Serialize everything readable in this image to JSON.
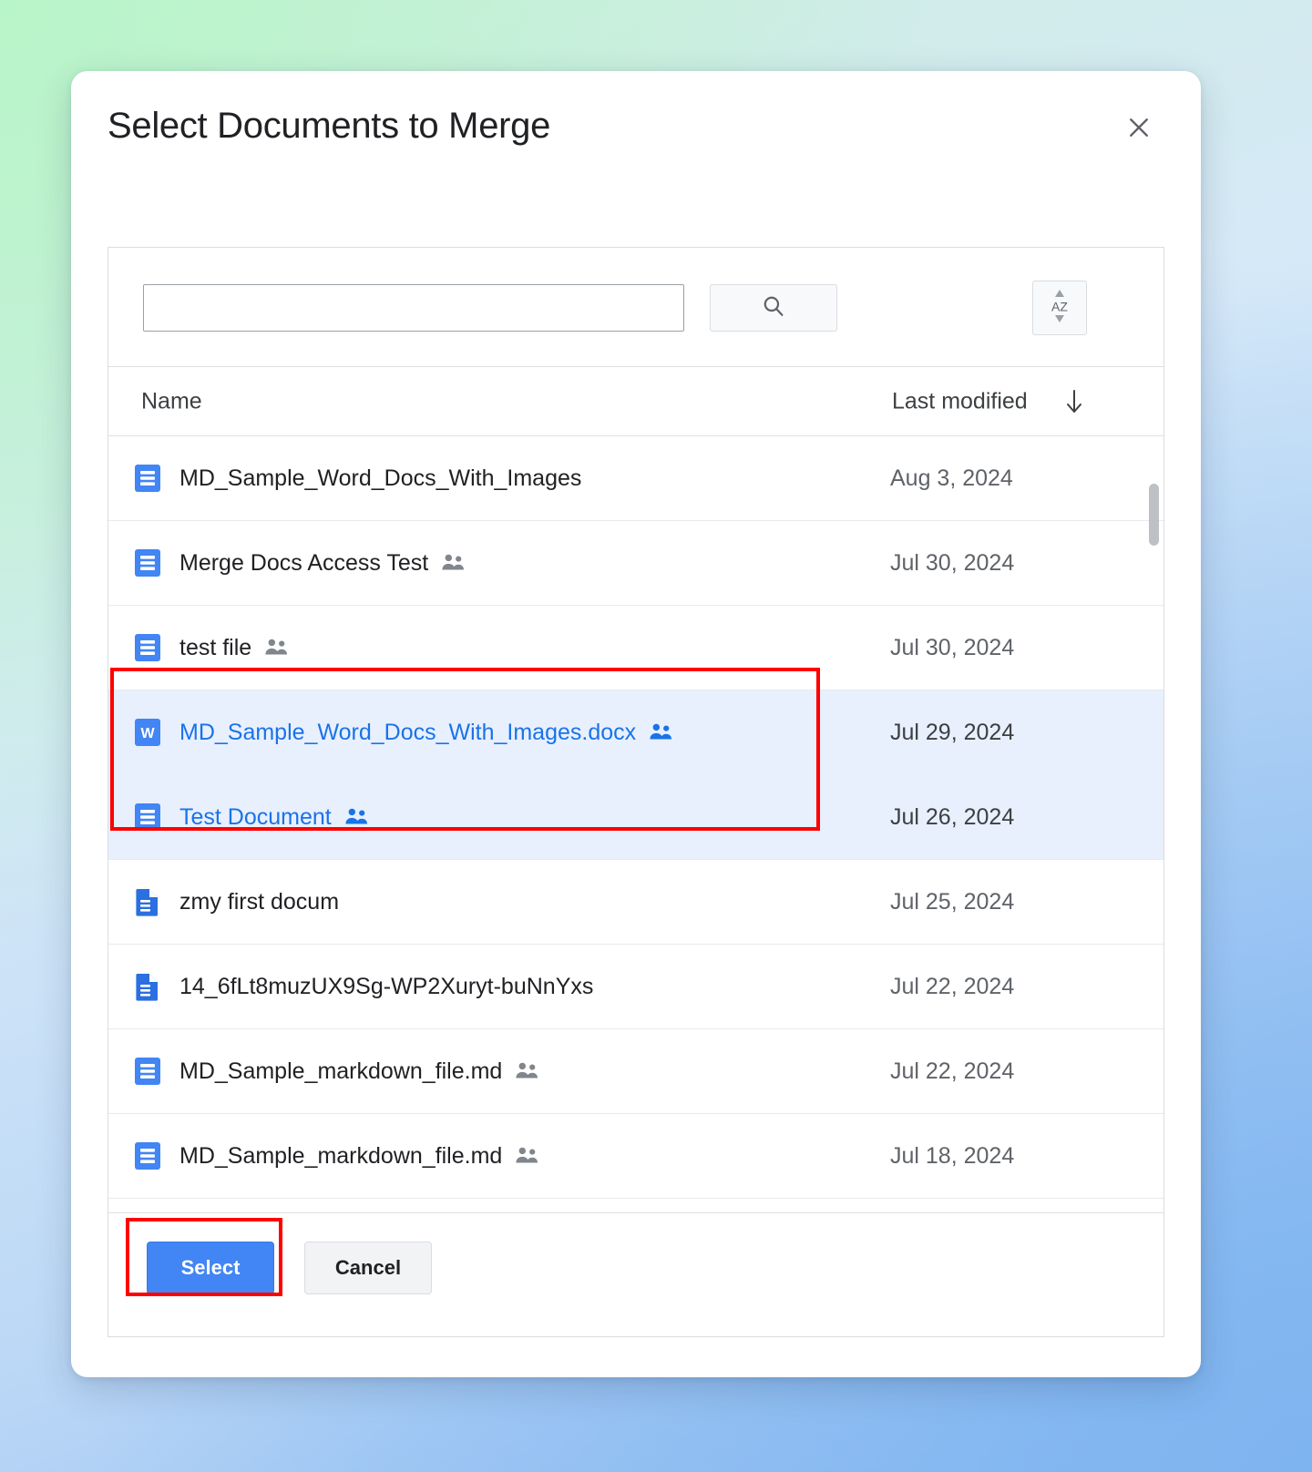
{
  "dialog": {
    "title": "Select Documents to Merge",
    "close_icon": "close-icon"
  },
  "toolbar": {
    "search_value": "",
    "search_placeholder": "",
    "search_button_icon": "search-icon",
    "sort_button_icon": "sort-az-icon",
    "sort_button_letters": "AZ"
  },
  "list": {
    "columns": {
      "name": "Name",
      "last_modified": "Last modified",
      "sort_direction_icon": "arrow-down-icon"
    },
    "rows": [
      {
        "name": "MD_Sample_Word_Docs_With_Images",
        "modified": "Aug 3, 2024",
        "icon": "google-docs-icon",
        "shared": false,
        "selected": false
      },
      {
        "name": "Merge Docs Access Test",
        "modified": "Jul 30, 2024",
        "icon": "google-docs-icon",
        "shared": true,
        "selected": false
      },
      {
        "name": "test file",
        "modified": "Jul 30, 2024",
        "icon": "google-docs-icon",
        "shared": true,
        "selected": false
      },
      {
        "name": "MD_Sample_Word_Docs_With_Images.docx",
        "modified": "Jul 29, 2024",
        "icon": "word-doc-icon",
        "shared": true,
        "selected": true
      },
      {
        "name": "Test Document",
        "modified": "Jul 26, 2024",
        "icon": "google-docs-icon",
        "shared": true,
        "selected": true
      },
      {
        "name": "zmy first docum",
        "modified": "Jul 25, 2024",
        "icon": "generic-document-icon",
        "shared": false,
        "selected": false
      },
      {
        "name": "14_6fLt8muzUX9Sg-WP2Xuryt-buNnYxs",
        "modified": "Jul 22, 2024",
        "icon": "generic-document-icon",
        "shared": false,
        "selected": false
      },
      {
        "name": "MD_Sample_markdown_file.md",
        "modified": "Jul 22, 2024",
        "icon": "google-docs-icon",
        "shared": true,
        "selected": false
      },
      {
        "name": "MD_Sample_markdown_file.md",
        "modified": "Jul 18, 2024",
        "icon": "google-docs-icon",
        "shared": true,
        "selected": false
      }
    ]
  },
  "footer": {
    "select_label": "Select",
    "cancel_label": "Cancel"
  },
  "colors": {
    "accent_blue": "#4285f4",
    "selected_row_bg": "#e8f0fe",
    "selected_text": "#1a73e8",
    "annotation_red": "#ff0000",
    "docs_icon_blue": "#4285f4",
    "word_icon_blue": "#185abc"
  }
}
